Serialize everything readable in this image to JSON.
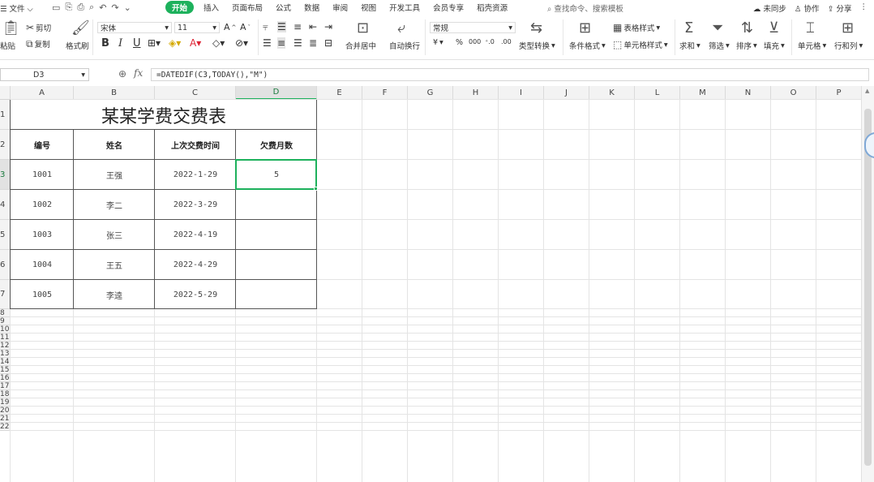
{
  "menubar": {
    "file_label": "☰ 文件 ⌵",
    "tabs": [
      "开始",
      "插入",
      "页面布局",
      "公式",
      "数据",
      "审阅",
      "视图",
      "开发工具",
      "会员专享",
      "稻壳资源"
    ],
    "active_tab": "开始",
    "search_placeholder": "查找命令、搜索模板",
    "sync_label": "未同步",
    "collab_label": "协作",
    "share_label": "分享"
  },
  "ribbon": {
    "paste": "粘贴",
    "cut": "剪切",
    "copy": "复制",
    "format_painter": "格式刷",
    "font_name": "宋体",
    "font_size": "11",
    "bold": "B",
    "italic": "I",
    "underline": "U",
    "merge_center": "合并居中",
    "wrap_text": "自动换行",
    "number_format": "常规",
    "currency": "¥",
    "percent": "%",
    "type_convert": "类型转换",
    "conditional_format": "条件格式",
    "table_style": "表格样式",
    "cell_style": "单元格样式",
    "sum": "求和",
    "filter": "筛选",
    "sort": "排序",
    "fill": "填充",
    "cell": "单元格",
    "row_col": "行和列"
  },
  "formula_bar": {
    "cell_ref": "D3",
    "formula": "=DATEDIF(C3,TODAY(),\"M\")",
    "fx": "fx"
  },
  "grid": {
    "columns": [
      "A",
      "B",
      "C",
      "D",
      "E",
      "F",
      "G",
      "H",
      "I",
      "J",
      "K",
      "L",
      "M",
      "N",
      "O",
      "P"
    ],
    "rows": [
      "1",
      "2",
      "3",
      "4",
      "5",
      "6",
      "7",
      "8",
      "9",
      "10",
      "11",
      "12",
      "13",
      "14",
      "15",
      "16",
      "17",
      "18",
      "19",
      "20",
      "21",
      "22"
    ],
    "selected_column": "D",
    "selected_row": "3"
  },
  "sheet": {
    "title": "某某学费交费表",
    "headers": [
      "编号",
      "姓名",
      "上次交费时间",
      "欠费月数"
    ],
    "rows": [
      [
        "1001",
        "王强",
        "2022-1-29",
        "5"
      ],
      [
        "1002",
        "李二",
        "2022-3-29",
        ""
      ],
      [
        "1003",
        "张三",
        "2022-4-19",
        ""
      ],
      [
        "1004",
        "王五",
        "2022-4-29",
        ""
      ],
      [
        "1005",
        "李逵",
        "2022-5-29",
        ""
      ]
    ]
  },
  "colors": {
    "accent": "#1db15c",
    "table_border": "#555555",
    "gridline": "#e4e4e4"
  }
}
